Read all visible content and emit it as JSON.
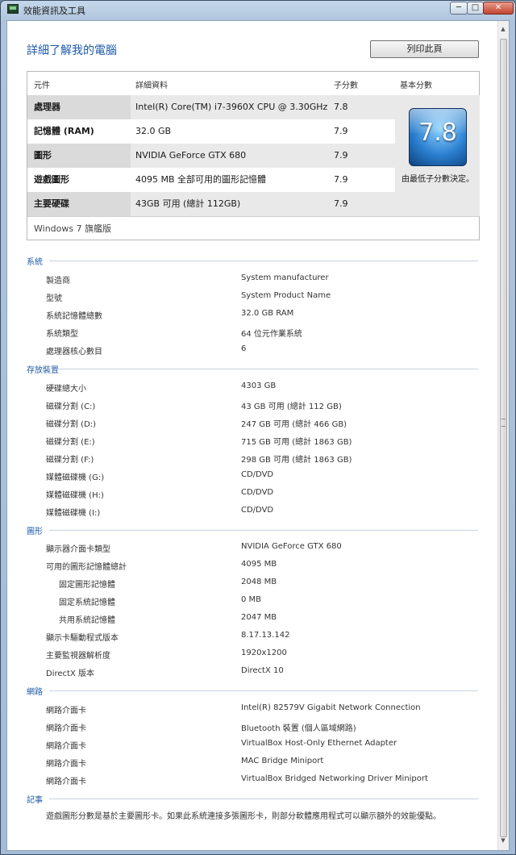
{
  "window": {
    "title": "效能資訊及工具"
  },
  "header": {
    "title": "詳細了解我的電腦",
    "print_label": "列印此頁"
  },
  "score_table": {
    "headers": [
      "元件",
      "詳細資料",
      "子分數",
      "基本分數"
    ],
    "rows": [
      {
        "component": "處理器",
        "detail": "Intel(R) Core(TM) i7-3960X CPU @ 3.30GHz",
        "subscore": "7.8"
      },
      {
        "component": "記憶體 (RAM)",
        "detail": "32.0 GB",
        "subscore": "7.9"
      },
      {
        "component": "圖形",
        "detail": "NVIDIA GeForce GTX 680",
        "subscore": "7.9"
      },
      {
        "component": "遊戲圖形",
        "detail": "4095 MB 全部可用的圖形記憶體",
        "subscore": "7.9"
      },
      {
        "component": "主要硬碟",
        "detail": "43GB 可用 (總計 112GB)",
        "subscore": "7.9"
      }
    ],
    "base_score": "7.8",
    "base_caption": "由最低子分數決定。",
    "edition": "Windows 7 旗艦版"
  },
  "sections": {
    "system": {
      "title": "系統",
      "items": [
        {
          "label": "製造商",
          "value": "System manufacturer"
        },
        {
          "label": "型號",
          "value": "System Product Name"
        },
        {
          "label": "系統記憶體總數",
          "value": "32.0 GB RAM"
        },
        {
          "label": "系統類型",
          "value": "64 位元作業系統"
        },
        {
          "label": "處理器核心數目",
          "value": "6"
        }
      ]
    },
    "storage": {
      "title": "存放裝置",
      "items": [
        {
          "label": "硬碟總大小",
          "value": "4303 GB"
        },
        {
          "label": "磁碟分割 (C:)",
          "value": "43 GB 可用 (總計 112 GB)"
        },
        {
          "label": "磁碟分割 (D:)",
          "value": "247 GB 可用 (總計 466 GB)"
        },
        {
          "label": "磁碟分割 (E:)",
          "value": "715 GB 可用 (總計 1863 GB)"
        },
        {
          "label": "磁碟分割 (F:)",
          "value": "298 GB 可用 (總計 1863 GB)"
        },
        {
          "label": "媒體磁碟機 (G:)",
          "value": "CD/DVD"
        },
        {
          "label": "媒體磁碟機 (H:)",
          "value": "CD/DVD"
        },
        {
          "label": "媒體磁碟機 (I:)",
          "value": "CD/DVD"
        }
      ]
    },
    "graphics": {
      "title": "圖形",
      "items": [
        {
          "label": "顯示器介面卡類型",
          "value": "NVIDIA GeForce GTX 680"
        },
        {
          "label": "可用的圖形記憶體總計",
          "value": "4095 MB"
        },
        {
          "label": "固定圖形記憶體",
          "value": "2048 MB"
        },
        {
          "label": "固定系統記憶體",
          "value": "0 MB"
        },
        {
          "label": "共用系統記憶體",
          "value": "2047 MB"
        },
        {
          "label": "顯示卡驅動程式版本",
          "value": "8.17.13.142"
        },
        {
          "label": "主要監視器解析度",
          "value": "1920x1200"
        },
        {
          "label": "DirectX 版本",
          "value": "DirectX 10"
        }
      ]
    },
    "network": {
      "title": "網路",
      "items": [
        {
          "label": "網路介面卡",
          "value": "Intel(R) 82579V Gigabit Network Connection"
        },
        {
          "label": "網路介面卡",
          "value": "Bluetooth 裝置 (個人區域網路)"
        },
        {
          "label": "網路介面卡",
          "value": "VirtualBox Host-Only Ethernet Adapter"
        },
        {
          "label": "網路介面卡",
          "value": "MAC Bridge Miniport"
        },
        {
          "label": "網路介面卡",
          "value": "VirtualBox Bridged Networking Driver Miniport"
        }
      ]
    },
    "notes": {
      "title": "記事",
      "text": "遊戲圖形分數是基於主要圖形卡。如果此系統連接多張圖形卡，則部分軟體應用程式可以顯示額外的效能優點。"
    }
  }
}
